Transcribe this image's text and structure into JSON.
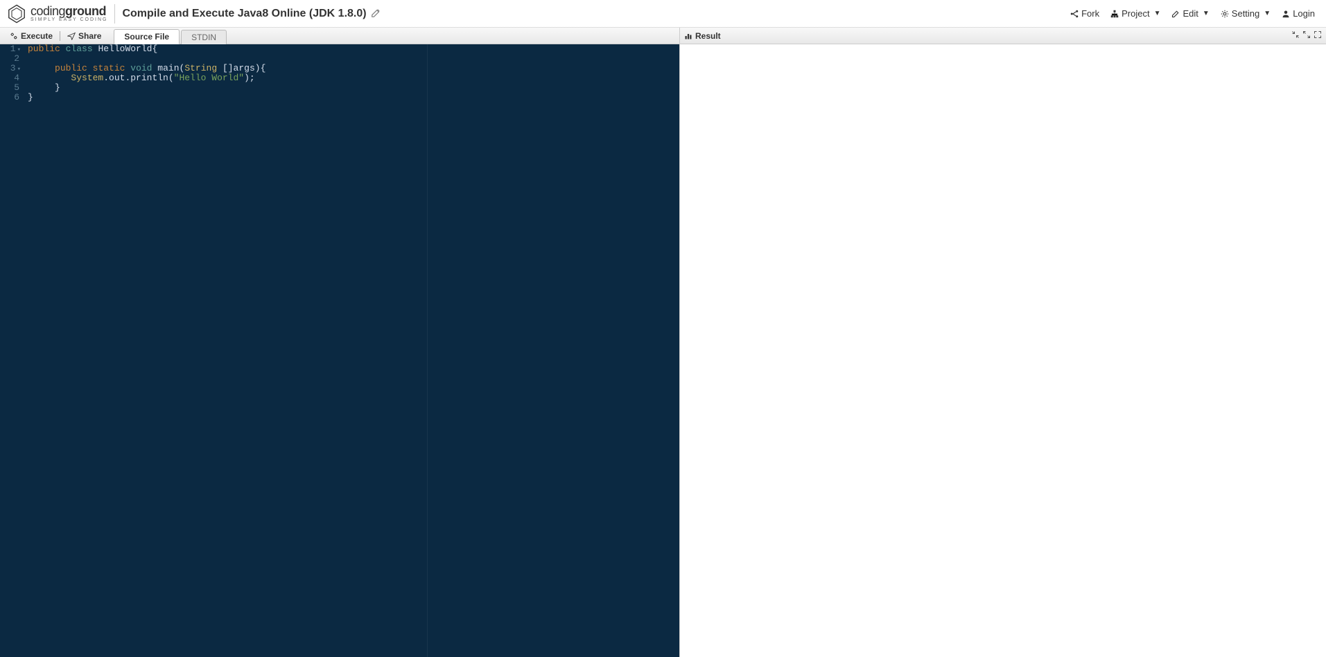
{
  "logo": {
    "main_coding": "coding",
    "main_ground": "ground",
    "sub": "SIMPLY EASY CODING"
  },
  "page_title": "Compile and Execute Java8 Online (JDK 1.8.0)",
  "header_menu": {
    "fork": "Fork",
    "project": "Project",
    "edit": "Edit",
    "setting": "Setting",
    "login": "Login"
  },
  "toolbar": {
    "execute": "Execute",
    "share": "Share"
  },
  "tabs": {
    "source": "Source File",
    "stdin": "STDIN"
  },
  "result_label": "Result",
  "code": {
    "line_numbers": [
      "1",
      "2",
      "3",
      "4",
      "5",
      "6"
    ],
    "tokens": {
      "l1_public": "public",
      "l1_class": "class",
      "l1_name": "HelloWorld",
      "l1_brace": "{",
      "l3_indent": "     ",
      "l3_public": "public",
      "l3_static": "static",
      "l3_void": "void",
      "l3_main": "main",
      "l3_paren_open": "(",
      "l3_type": "String",
      "l3_args": " []args",
      "l3_paren_close": ")",
      "l3_brace": "{",
      "l4_indent": "        ",
      "l4_sys": "System",
      "l4_dot_out": ".out.println(",
      "l4_str": "\"Hello World\"",
      "l4_end": ");",
      "l5_indent": "     ",
      "l5_brace": "}",
      "l6_brace": "}"
    }
  }
}
